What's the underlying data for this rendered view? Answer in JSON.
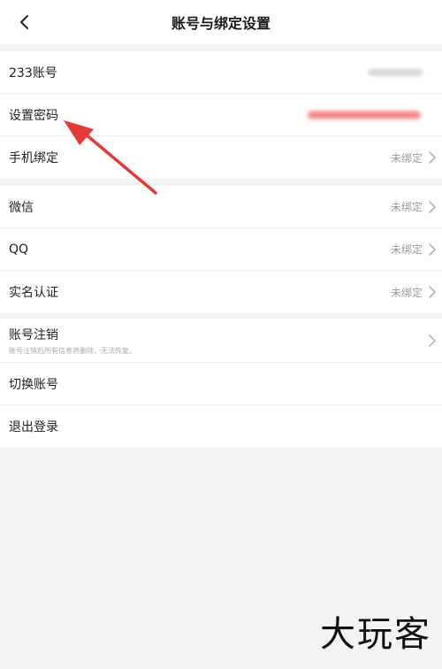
{
  "header": {
    "title": "账号与绑定设置"
  },
  "group1": [
    {
      "label": "233账号"
    },
    {
      "label": "设置密码"
    },
    {
      "label": "手机绑定",
      "value": "未绑定"
    }
  ],
  "group2": [
    {
      "label": "微信",
      "value": "未绑定"
    },
    {
      "label": "QQ",
      "value": "未绑定"
    },
    {
      "label": "实名认证",
      "value": "未绑定"
    }
  ],
  "group3": {
    "cancel": {
      "label": "账号注销",
      "sub": "账号注销后所有信息将删除，无法恢复。"
    },
    "switch": {
      "label": "切换账号"
    },
    "logout": {
      "label": "退出登录"
    }
  },
  "watermark": "大玩客",
  "colors": {
    "annotation_arrow": "#e53935",
    "muted_text": "#9a9a9a",
    "background": "#f3f3f3"
  }
}
